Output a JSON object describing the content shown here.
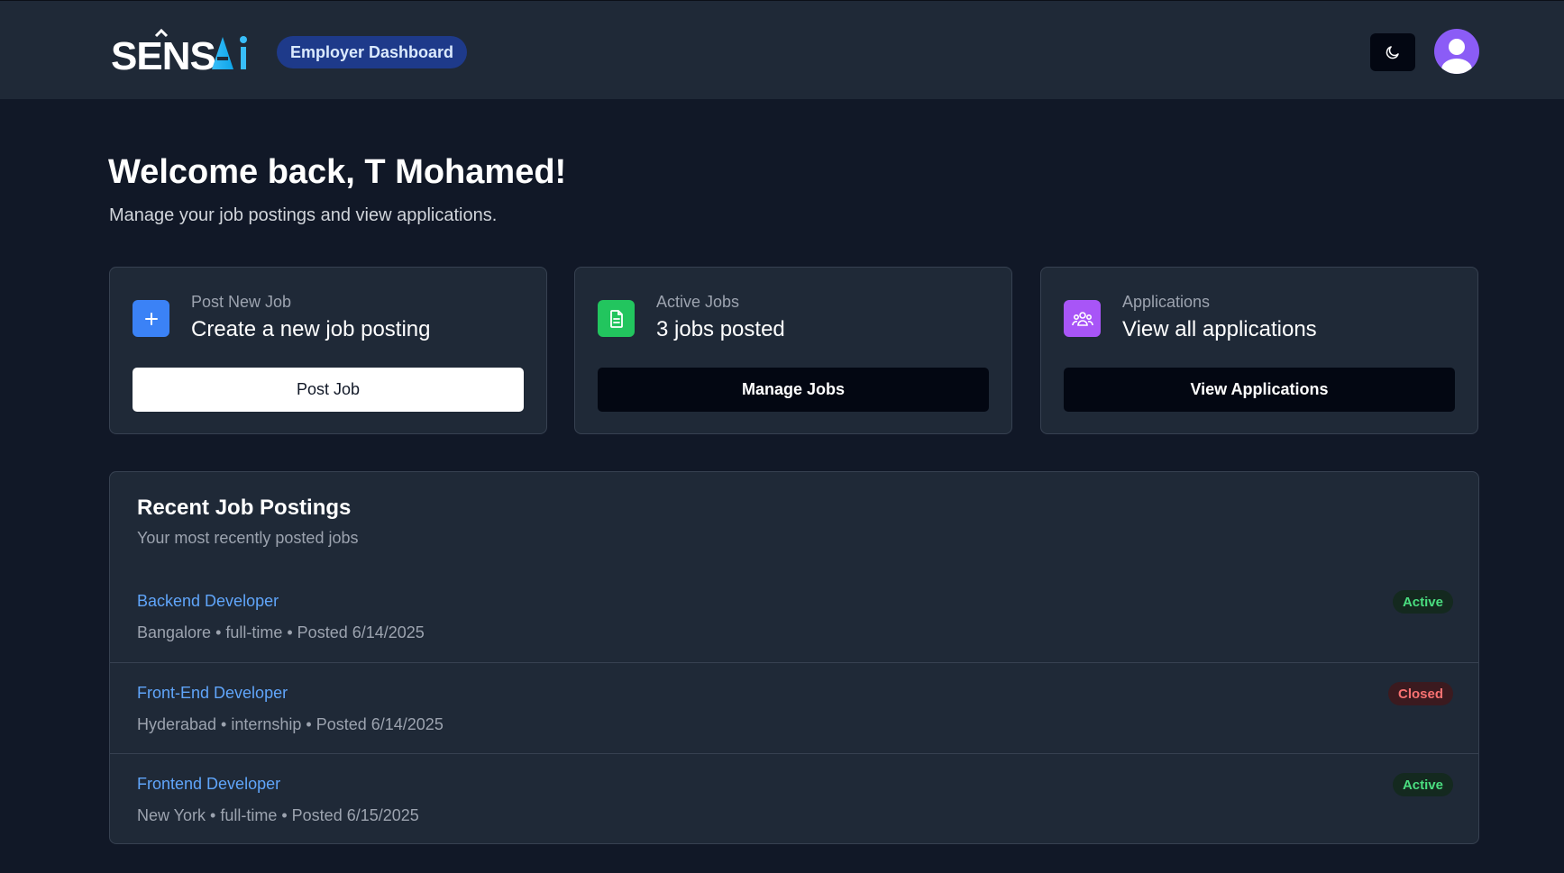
{
  "header": {
    "logo_text": "SENSAi",
    "badge": "Employer Dashboard"
  },
  "colors": {
    "background": "#111827",
    "card": "#1f2937",
    "accent_blue": "#3b82f6",
    "accent_green": "#22c55e",
    "accent_purple": "#a855f7",
    "link": "#60a5fa"
  },
  "welcome": {
    "title": "Welcome back, T Mohamed!",
    "subtitle": "Manage your job postings and view applications."
  },
  "cards": [
    {
      "icon": "plus-icon",
      "label": "Post New Job",
      "value": "Create a new job posting",
      "button": "Post Job"
    },
    {
      "icon": "document-icon",
      "label": "Active Jobs",
      "value": "3 jobs posted",
      "button": "Manage Jobs"
    },
    {
      "icon": "users-icon",
      "label": "Applications",
      "value": "View all applications",
      "button": "View Applications"
    }
  ],
  "recent": {
    "title": "Recent Job Postings",
    "subtitle": "Your most recently posted jobs",
    "jobs": [
      {
        "title": "Backend Developer",
        "meta": "Bangalore • full-time • Posted 6/14/2025",
        "status": "Active"
      },
      {
        "title": "Front-End Developer",
        "meta": "Hyderabad • internship • Posted 6/14/2025",
        "status": "Closed"
      },
      {
        "title": "Frontend Developer",
        "meta": "New York • full-time • Posted 6/15/2025",
        "status": "Active"
      }
    ]
  }
}
